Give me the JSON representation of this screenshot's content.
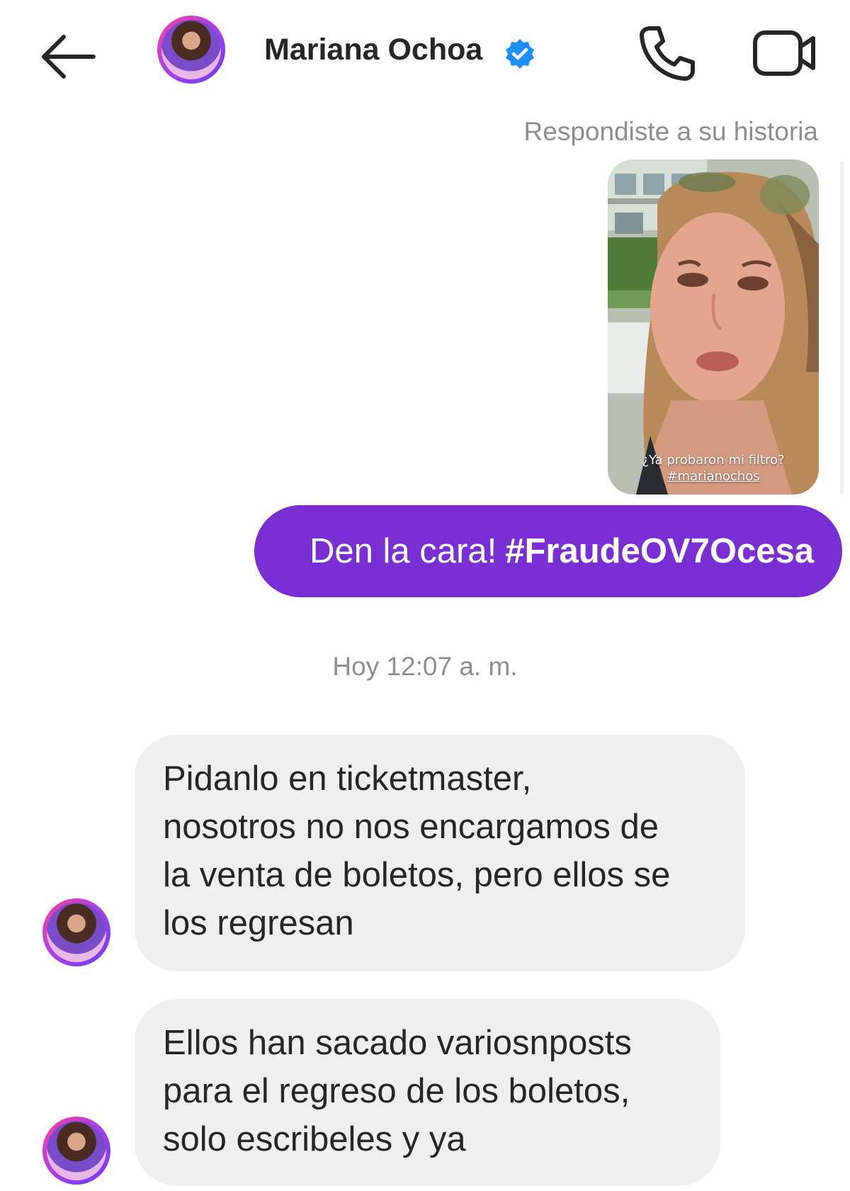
{
  "header": {
    "back_icon": "back-arrow-icon",
    "contact_name": "Mariana Ochoa",
    "verified_icon": "verified-badge-icon",
    "call_icon": "phone-icon",
    "video_icon": "video-camera-icon"
  },
  "story_reply": {
    "note": "Respondiste a su historia",
    "caption_line1": "¿Ya probaron mi filtro?",
    "caption_line2": "#marianochos"
  },
  "sent_message": {
    "text": "Den la cara!",
    "hashtag": "#FraudeOV7Ocesa",
    "bubble_color": "#7a2fd4"
  },
  "timestamp": "Hoy 12:07 a. m.",
  "received_messages": [
    {
      "lines": [
        "Pidanlo en ticketmaster,",
        "nosotros no nos encargamos de",
        "la venta de boletos, pero ellos se",
        "los regresan"
      ]
    },
    {
      "lines": [
        "Ellos han sacado variosnposts",
        "para el regreso de los boletos,",
        "solo escribeles y ya"
      ]
    }
  ],
  "colors": {
    "secondary_text": "#8e8e8e",
    "received_bubble": "#efefef",
    "verified_blue": "#1f8fff"
  }
}
